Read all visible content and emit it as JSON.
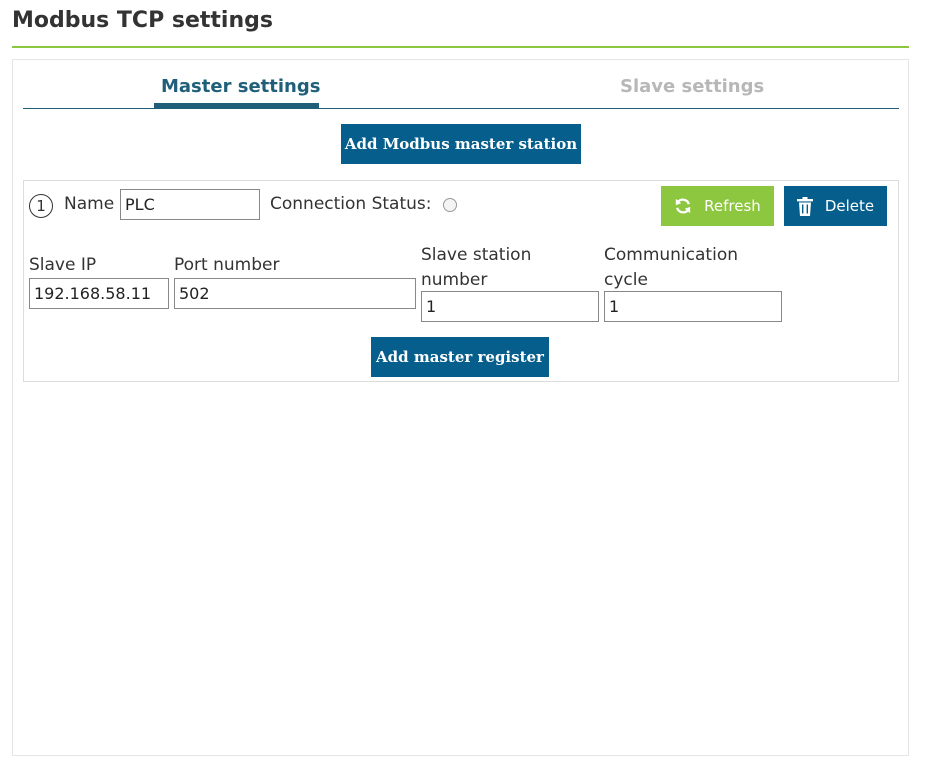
{
  "page": {
    "title": "Modbus TCP settings"
  },
  "tabs": [
    {
      "label": "Master settings",
      "active": true
    },
    {
      "label": "Slave settings",
      "active": false
    }
  ],
  "add_station_button": "Add Modbus master station",
  "station": {
    "index": "1",
    "name_label": "Name",
    "name_value": "PLC",
    "connection_status_label": "Connection Status:",
    "refresh_button": "Refresh",
    "delete_button": "Delete",
    "slave_ip_label": "Slave IP",
    "slave_ip_value": "192.168.58.11",
    "port_label": "Port number",
    "port_value": "502",
    "station_number_label": "Slave station number",
    "station_number_value": "1",
    "cycle_label": "Communication cycle",
    "cycle_value": "1",
    "add_register_button": "Add master register"
  },
  "icons": {
    "refresh": "refresh-icon",
    "delete": "trash-icon"
  },
  "colors": {
    "primary": "#065e8c",
    "accent_green": "#8dc63f",
    "tab_inactive": "#b7b7b7"
  }
}
